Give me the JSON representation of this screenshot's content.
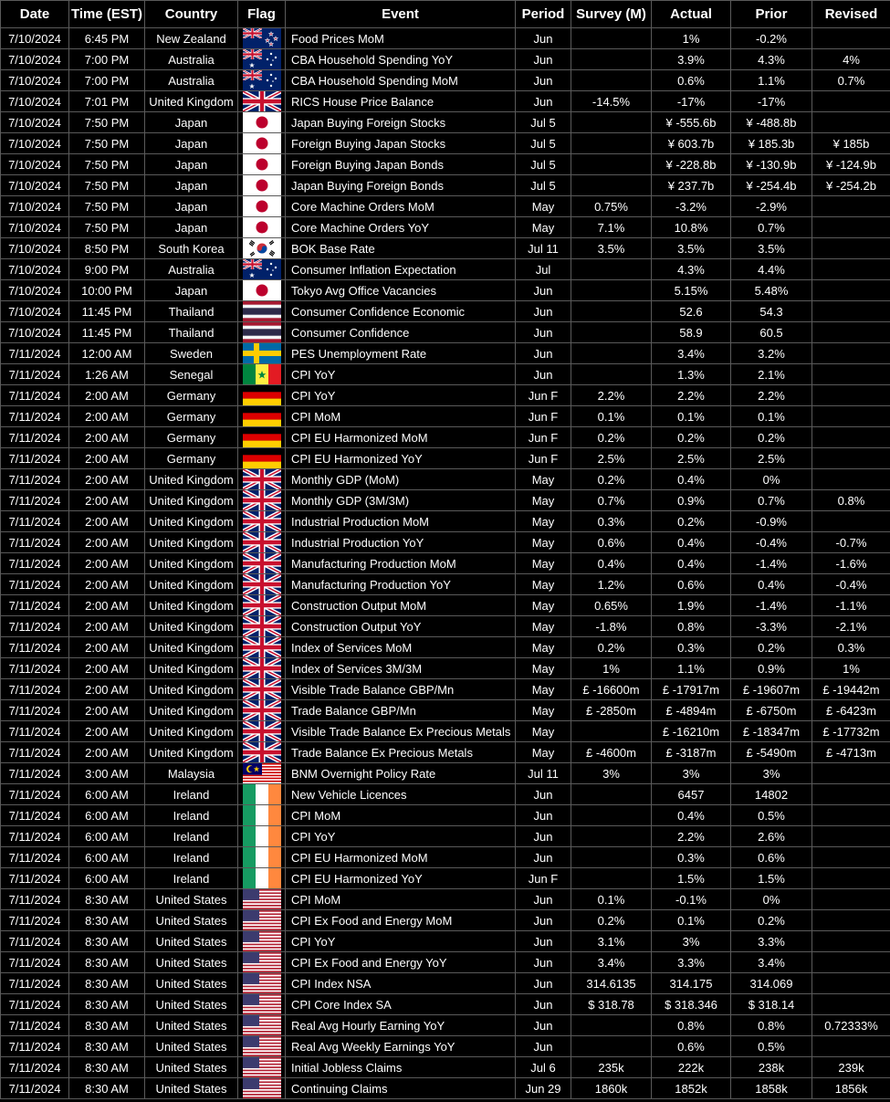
{
  "headers": [
    "Date",
    "Time (EST)",
    "Country",
    "Flag",
    "Event",
    "Period",
    "Survey (M)",
    "Actual",
    "Prior",
    "Revised"
  ],
  "flag_icons": {
    "NZ": "new-zealand-flag-icon",
    "AU": "australia-flag-icon",
    "UK": "united-kingdom-flag-icon",
    "JP": "japan-flag-icon",
    "KR": "south-korea-flag-icon",
    "TH": "thailand-flag-icon",
    "SE": "sweden-flag-icon",
    "SN": "senegal-flag-icon",
    "DE": "germany-flag-icon",
    "MY": "malaysia-flag-icon",
    "IE": "ireland-flag-icon",
    "US": "united-states-flag-icon"
  },
  "rows": [
    {
      "date": "7/10/2024",
      "time": "6:45 PM",
      "country": "New Zealand",
      "flag": "NZ",
      "event": "Food Prices MoM",
      "period": "Jun",
      "survey": "",
      "actual": "1%",
      "prior": "-0.2%",
      "revised": ""
    },
    {
      "date": "7/10/2024",
      "time": "7:00 PM",
      "country": "Australia",
      "flag": "AU",
      "event": "CBA Household Spending YoY",
      "period": "Jun",
      "survey": "",
      "actual": "3.9%",
      "prior": "4.3%",
      "revised": "4%"
    },
    {
      "date": "7/10/2024",
      "time": "7:00 PM",
      "country": "Australia",
      "flag": "AU",
      "event": "CBA Household Spending MoM",
      "period": "Jun",
      "survey": "",
      "actual": "0.6%",
      "prior": "1.1%",
      "revised": "0.7%"
    },
    {
      "date": "7/10/2024",
      "time": "7:01 PM",
      "country": "United Kingdom",
      "flag": "UK",
      "event": "RICS House Price Balance",
      "period": "Jun",
      "survey": "-14.5%",
      "actual": "-17%",
      "prior": "-17%",
      "revised": ""
    },
    {
      "date": "7/10/2024",
      "time": "7:50 PM",
      "country": "Japan",
      "flag": "JP",
      "event": "Japan Buying Foreign Stocks",
      "period": "Jul 5",
      "survey": "",
      "actual": "¥ -555.6b",
      "prior": "¥ -488.8b",
      "revised": ""
    },
    {
      "date": "7/10/2024",
      "time": "7:50 PM",
      "country": "Japan",
      "flag": "JP",
      "event": "Foreign Buying Japan Stocks",
      "period": "Jul 5",
      "survey": "",
      "actual": "¥ 603.7b",
      "prior": "¥ 185.3b",
      "revised": "¥ 185b"
    },
    {
      "date": "7/10/2024",
      "time": "7:50 PM",
      "country": "Japan",
      "flag": "JP",
      "event": "Foreign Buying Japan Bonds",
      "period": "Jul 5",
      "survey": "",
      "actual": "¥ -228.8b",
      "prior": "¥ -130.9b",
      "revised": "¥ -124.9b"
    },
    {
      "date": "7/10/2024",
      "time": "7:50 PM",
      "country": "Japan",
      "flag": "JP",
      "event": "Japan Buying Foreign Bonds",
      "period": "Jul 5",
      "survey": "",
      "actual": "¥ 237.7b",
      "prior": "¥ -254.4b",
      "revised": "¥ -254.2b"
    },
    {
      "date": "7/10/2024",
      "time": "7:50 PM",
      "country": "Japan",
      "flag": "JP",
      "event": "Core Machine Orders MoM",
      "period": "May",
      "survey": "0.75%",
      "actual": "-3.2%",
      "prior": "-2.9%",
      "revised": ""
    },
    {
      "date": "7/10/2024",
      "time": "7:50 PM",
      "country": "Japan",
      "flag": "JP",
      "event": "Core Machine Orders YoY",
      "period": "May",
      "survey": "7.1%",
      "actual": "10.8%",
      "prior": "0.7%",
      "revised": ""
    },
    {
      "date": "7/10/2024",
      "time": "8:50 PM",
      "country": "South Korea",
      "flag": "KR",
      "event": "BOK Base Rate",
      "period": "Jul 11",
      "survey": "3.5%",
      "actual": "3.5%",
      "prior": "3.5%",
      "revised": ""
    },
    {
      "date": "7/10/2024",
      "time": "9:00 PM",
      "country": "Australia",
      "flag": "AU",
      "event": "Consumer Inflation Expectation",
      "period": "Jul",
      "survey": "",
      "actual": "4.3%",
      "prior": "4.4%",
      "revised": ""
    },
    {
      "date": "7/10/2024",
      "time": "10:00 PM",
      "country": "Japan",
      "flag": "JP",
      "event": "Tokyo Avg Office Vacancies",
      "period": "Jun",
      "survey": "",
      "actual": "5.15%",
      "prior": "5.48%",
      "revised": ""
    },
    {
      "date": "7/10/2024",
      "time": "11:45 PM",
      "country": "Thailand",
      "flag": "TH",
      "event": "Consumer Confidence Economic",
      "period": "Jun",
      "survey": "",
      "actual": "52.6",
      "prior": "54.3",
      "revised": ""
    },
    {
      "date": "7/10/2024",
      "time": "11:45 PM",
      "country": "Thailand",
      "flag": "TH",
      "event": "Consumer Confidence",
      "period": "Jun",
      "survey": "",
      "actual": "58.9",
      "prior": "60.5",
      "revised": ""
    },
    {
      "date": "7/11/2024",
      "time": "12:00 AM",
      "country": "Sweden",
      "flag": "SE",
      "event": "PES Unemployment Rate",
      "period": "Jun",
      "survey": "",
      "actual": "3.4%",
      "prior": "3.2%",
      "revised": ""
    },
    {
      "date": "7/11/2024",
      "time": "1:26 AM",
      "country": "Senegal",
      "flag": "SN",
      "event": "CPI YoY",
      "period": "Jun",
      "survey": "",
      "actual": "1.3%",
      "prior": "2.1%",
      "revised": ""
    },
    {
      "date": "7/11/2024",
      "time": "2:00 AM",
      "country": "Germany",
      "flag": "DE",
      "event": "CPI YoY",
      "period": "Jun F",
      "survey": "2.2%",
      "actual": "2.2%",
      "prior": "2.2%",
      "revised": ""
    },
    {
      "date": "7/11/2024",
      "time": "2:00 AM",
      "country": "Germany",
      "flag": "DE",
      "event": "CPI MoM",
      "period": "Jun F",
      "survey": "0.1%",
      "actual": "0.1%",
      "prior": "0.1%",
      "revised": ""
    },
    {
      "date": "7/11/2024",
      "time": "2:00 AM",
      "country": "Germany",
      "flag": "DE",
      "event": "CPI EU Harmonized MoM",
      "period": "Jun F",
      "survey": "0.2%",
      "actual": "0.2%",
      "prior": "0.2%",
      "revised": ""
    },
    {
      "date": "7/11/2024",
      "time": "2:00 AM",
      "country": "Germany",
      "flag": "DE",
      "event": "CPI EU Harmonized YoY",
      "period": "Jun F",
      "survey": "2.5%",
      "actual": "2.5%",
      "prior": "2.5%",
      "revised": ""
    },
    {
      "date": "7/11/2024",
      "time": "2:00 AM",
      "country": "United Kingdom",
      "flag": "UK",
      "event": "Monthly GDP (MoM)",
      "period": "May",
      "survey": "0.2%",
      "actual": "0.4%",
      "prior": "0%",
      "revised": ""
    },
    {
      "date": "7/11/2024",
      "time": "2:00 AM",
      "country": "United Kingdom",
      "flag": "UK",
      "event": "Monthly GDP (3M/3M)",
      "period": "May",
      "survey": "0.7%",
      "actual": "0.9%",
      "prior": "0.7%",
      "revised": "0.8%"
    },
    {
      "date": "7/11/2024",
      "time": "2:00 AM",
      "country": "United Kingdom",
      "flag": "UK",
      "event": "Industrial Production MoM",
      "period": "May",
      "survey": "0.3%",
      "actual": "0.2%",
      "prior": "-0.9%",
      "revised": ""
    },
    {
      "date": "7/11/2024",
      "time": "2:00 AM",
      "country": "United Kingdom",
      "flag": "UK",
      "event": "Industrial Production YoY",
      "period": "May",
      "survey": "0.6%",
      "actual": "0.4%",
      "prior": "-0.4%",
      "revised": "-0.7%"
    },
    {
      "date": "7/11/2024",
      "time": "2:00 AM",
      "country": "United Kingdom",
      "flag": "UK",
      "event": "Manufacturing Production MoM",
      "period": "May",
      "survey": "0.4%",
      "actual": "0.4%",
      "prior": "-1.4%",
      "revised": "-1.6%"
    },
    {
      "date": "7/11/2024",
      "time": "2:00 AM",
      "country": "United Kingdom",
      "flag": "UK",
      "event": "Manufacturing Production YoY",
      "period": "May",
      "survey": "1.2%",
      "actual": "0.6%",
      "prior": "0.4%",
      "revised": "-0.4%"
    },
    {
      "date": "7/11/2024",
      "time": "2:00 AM",
      "country": "United Kingdom",
      "flag": "UK",
      "event": "Construction Output MoM",
      "period": "May",
      "survey": "0.65%",
      "actual": "1.9%",
      "prior": "-1.4%",
      "revised": "-1.1%"
    },
    {
      "date": "7/11/2024",
      "time": "2:00 AM",
      "country": "United Kingdom",
      "flag": "UK",
      "event": "Construction Output YoY",
      "period": "May",
      "survey": "-1.8%",
      "actual": "0.8%",
      "prior": "-3.3%",
      "revised": "-2.1%"
    },
    {
      "date": "7/11/2024",
      "time": "2:00 AM",
      "country": "United Kingdom",
      "flag": "UK",
      "event": "Index of Services MoM",
      "period": "May",
      "survey": "0.2%",
      "actual": "0.3%",
      "prior": "0.2%",
      "revised": "0.3%"
    },
    {
      "date": "7/11/2024",
      "time": "2:00 AM",
      "country": "United Kingdom",
      "flag": "UK",
      "event": "Index of Services 3M/3M",
      "period": "May",
      "survey": "1%",
      "actual": "1.1%",
      "prior": "0.9%",
      "revised": "1%"
    },
    {
      "date": "7/11/2024",
      "time": "2:00 AM",
      "country": "United Kingdom",
      "flag": "UK",
      "event": "Visible Trade Balance GBP/Mn",
      "period": "May",
      "survey": "£ -16600m",
      "actual": "£ -17917m",
      "prior": "£ -19607m",
      "revised": "£ -19442m"
    },
    {
      "date": "7/11/2024",
      "time": "2:00 AM",
      "country": "United Kingdom",
      "flag": "UK",
      "event": "Trade Balance GBP/Mn",
      "period": "May",
      "survey": "£ -2850m",
      "actual": "£ -4894m",
      "prior": "£ -6750m",
      "revised": "£ -6423m"
    },
    {
      "date": "7/11/2024",
      "time": "2:00 AM",
      "country": "United Kingdom",
      "flag": "UK",
      "event": "Visible Trade Balance Ex Precious Metals",
      "period": "May",
      "survey": "",
      "actual": "£ -16210m",
      "prior": "£ -18347m",
      "revised": "£ -17732m"
    },
    {
      "date": "7/11/2024",
      "time": "2:00 AM",
      "country": "United Kingdom",
      "flag": "UK",
      "event": "Trade Balance Ex Precious Metals",
      "period": "May",
      "survey": "£ -4600m",
      "actual": "£ -3187m",
      "prior": "£ -5490m",
      "revised": "£ -4713m"
    },
    {
      "date": "7/11/2024",
      "time": "3:00 AM",
      "country": "Malaysia",
      "flag": "MY",
      "event": "BNM Overnight Policy Rate",
      "period": "Jul 11",
      "survey": "3%",
      "actual": "3%",
      "prior": "3%",
      "revised": ""
    },
    {
      "date": "7/11/2024",
      "time": "6:00 AM",
      "country": "Ireland",
      "flag": "IE",
      "event": "New Vehicle Licences",
      "period": "Jun",
      "survey": "",
      "actual": "6457",
      "prior": "14802",
      "revised": ""
    },
    {
      "date": "7/11/2024",
      "time": "6:00 AM",
      "country": "Ireland",
      "flag": "IE",
      "event": "CPI MoM",
      "period": "Jun",
      "survey": "",
      "actual": "0.4%",
      "prior": "0.5%",
      "revised": ""
    },
    {
      "date": "7/11/2024",
      "time": "6:00 AM",
      "country": "Ireland",
      "flag": "IE",
      "event": "CPI YoY",
      "period": "Jun",
      "survey": "",
      "actual": "2.2%",
      "prior": "2.6%",
      "revised": ""
    },
    {
      "date": "7/11/2024",
      "time": "6:00 AM",
      "country": "Ireland",
      "flag": "IE",
      "event": "CPI EU Harmonized MoM",
      "period": "Jun",
      "survey": "",
      "actual": "0.3%",
      "prior": "0.6%",
      "revised": ""
    },
    {
      "date": "7/11/2024",
      "time": "6:00 AM",
      "country": "Ireland",
      "flag": "IE",
      "event": "CPI EU Harmonized YoY",
      "period": "Jun F",
      "survey": "",
      "actual": "1.5%",
      "prior": "1.5%",
      "revised": ""
    },
    {
      "date": "7/11/2024",
      "time": "8:30 AM",
      "country": "United States",
      "flag": "US",
      "event": "CPI MoM",
      "period": "Jun",
      "survey": "0.1%",
      "actual": "-0.1%",
      "prior": "0%",
      "revised": ""
    },
    {
      "date": "7/11/2024",
      "time": "8:30 AM",
      "country": "United States",
      "flag": "US",
      "event": "CPI Ex Food and Energy MoM",
      "period": "Jun",
      "survey": "0.2%",
      "actual": "0.1%",
      "prior": "0.2%",
      "revised": ""
    },
    {
      "date": "7/11/2024",
      "time": "8:30 AM",
      "country": "United States",
      "flag": "US",
      "event": "CPI YoY",
      "period": "Jun",
      "survey": "3.1%",
      "actual": "3%",
      "prior": "3.3%",
      "revised": ""
    },
    {
      "date": "7/11/2024",
      "time": "8:30 AM",
      "country": "United States",
      "flag": "US",
      "event": "CPI Ex Food and Energy YoY",
      "period": "Jun",
      "survey": "3.4%",
      "actual": "3.3%",
      "prior": "3.4%",
      "revised": ""
    },
    {
      "date": "7/11/2024",
      "time": "8:30 AM",
      "country": "United States",
      "flag": "US",
      "event": "CPI Index NSA",
      "period": "Jun",
      "survey": "314.6135",
      "actual": "314.175",
      "prior": "314.069",
      "revised": ""
    },
    {
      "date": "7/11/2024",
      "time": "8:30 AM",
      "country": "United States",
      "flag": "US",
      "event": "CPI Core Index SA",
      "period": "Jun",
      "survey": "$ 318.78",
      "actual": "$ 318.346",
      "prior": "$ 318.14",
      "revised": ""
    },
    {
      "date": "7/11/2024",
      "time": "8:30 AM",
      "country": "United States",
      "flag": "US",
      "event": "Real Avg Hourly Earning YoY",
      "period": "Jun",
      "survey": "",
      "actual": "0.8%",
      "prior": "0.8%",
      "revised": "0.72333%"
    },
    {
      "date": "7/11/2024",
      "time": "8:30 AM",
      "country": "United States",
      "flag": "US",
      "event": "Real Avg Weekly Earnings YoY",
      "period": "Jun",
      "survey": "",
      "actual": "0.6%",
      "prior": "0.5%",
      "revised": ""
    },
    {
      "date": "7/11/2024",
      "time": "8:30 AM",
      "country": "United States",
      "flag": "US",
      "event": "Initial Jobless Claims",
      "period": "Jul 6",
      "survey": "235k",
      "actual": "222k",
      "prior": "238k",
      "revised": "239k"
    },
    {
      "date": "7/11/2024",
      "time": "8:30 AM",
      "country": "United States",
      "flag": "US",
      "event": "Continuing Claims",
      "period": "Jun 29",
      "survey": "1860k",
      "actual": "1852k",
      "prior": "1858k",
      "revised": "1856k"
    }
  ]
}
